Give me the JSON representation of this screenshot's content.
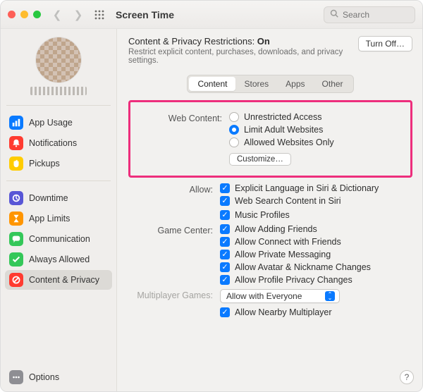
{
  "header": {
    "title": "Screen Time",
    "search_placeholder": "Search"
  },
  "sidebar": {
    "username": "",
    "items": [
      {
        "label": "App Usage",
        "icon": "bar-chart-icon",
        "color": "#0a7aff"
      },
      {
        "label": "Notifications",
        "icon": "bell-icon",
        "color": "#ff3b30"
      },
      {
        "label": "Pickups",
        "icon": "hand-icon",
        "color": "#ffcc00"
      }
    ],
    "items2": [
      {
        "label": "Downtime",
        "icon": "moon-icon",
        "color": "#5856d6"
      },
      {
        "label": "App Limits",
        "icon": "hourglass-icon",
        "color": "#ff9500"
      },
      {
        "label": "Communication",
        "icon": "chat-icon",
        "color": "#34c759"
      },
      {
        "label": "Always Allowed",
        "icon": "check-icon",
        "color": "#34c759"
      },
      {
        "label": "Content & Privacy",
        "icon": "nosign-icon",
        "color": "#ff3b30",
        "selected": true
      }
    ],
    "options_label": "Options"
  },
  "content": {
    "title_prefix": "Content & Privacy Restrictions: ",
    "title_state": "On",
    "subtitle": "Restrict explicit content, purchases, downloads, and privacy settings.",
    "turn_off_label": "Turn Off…",
    "tabs": [
      "Content",
      "Stores",
      "Apps",
      "Other"
    ],
    "active_tab": 0,
    "web_content": {
      "label": "Web Content:",
      "options": [
        "Unrestricted Access",
        "Limit Adult Websites",
        "Allowed Websites Only"
      ],
      "selected": 1,
      "customize_label": "Customize…"
    },
    "allow": {
      "label": "Allow:",
      "items": [
        {
          "label": "Explicit Language in Siri & Dictionary",
          "checked": true
        },
        {
          "label": "Web Search Content in Siri",
          "checked": true
        }
      ],
      "items2": [
        {
          "label": "Music Profiles",
          "checked": true
        }
      ]
    },
    "game_center": {
      "label": "Game Center:",
      "items": [
        {
          "label": "Allow Adding Friends",
          "checked": true
        },
        {
          "label": "Allow Connect with Friends",
          "checked": true
        },
        {
          "label": "Allow Private Messaging",
          "checked": true
        },
        {
          "label": "Allow Avatar & Nickname Changes",
          "checked": true
        },
        {
          "label": "Allow Profile Privacy Changes",
          "checked": true
        }
      ]
    },
    "multiplayer": {
      "label": "Multiplayer Games:",
      "popup_value": "Allow with Everyone",
      "nearby": {
        "label": "Allow Nearby Multiplayer",
        "checked": true
      }
    }
  },
  "help_label": "?"
}
